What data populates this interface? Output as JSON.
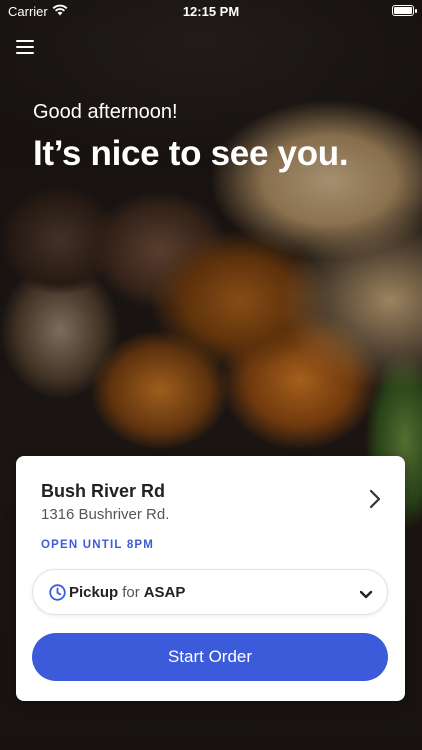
{
  "status_bar": {
    "carrier": "Carrier",
    "time": "12:15 PM"
  },
  "greeting": "Good afternoon!",
  "headline": "It’s nice to see you.",
  "store": {
    "name": "Bush River Rd",
    "address": "1316 Bushriver Rd.",
    "hours": "OPEN UNTIL 8PM"
  },
  "order_mode": {
    "mode": "Pickup",
    "for": "for",
    "time": "ASAP"
  },
  "cta": {
    "label": "Start Order"
  },
  "colors": {
    "accent": "#3b5bdb",
    "card_bg": "#ffffff"
  }
}
